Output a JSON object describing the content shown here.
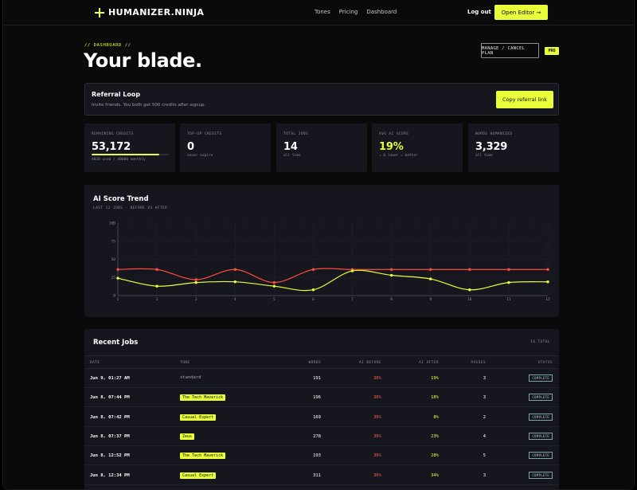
{
  "nav": {
    "logo": "HUMANIZER.NINJA",
    "links": [
      "Tones",
      "Pricing",
      "Dashboard"
    ],
    "logout": "Log out",
    "cta": "Open Editor →"
  },
  "header": {
    "eyebrow": "// DASHBOARD //",
    "title": "Your blade.",
    "manage_button": "MANAGE / CANCEL PLAN",
    "plan_badge": "PRO"
  },
  "referral": {
    "title": "Referral Loop",
    "subtitle": "Invite friends. You both get 500 credits after signup.",
    "button": "Copy referral link"
  },
  "stats": [
    {
      "label": "REMAINING CREDITS",
      "value": "53,172",
      "sub": "4828 used / 40000 monthly",
      "progress": 0.88
    },
    {
      "label": "TOP-UP CREDITS",
      "value": "0",
      "sub": "never expire"
    },
    {
      "label": "TOTAL JOBS",
      "value": "14",
      "sub": "all time"
    },
    {
      "label": "AVG AI SCORE",
      "value": "19%",
      "sub": "↘ & lower = better",
      "accent": true
    },
    {
      "label": "WORDS HUMANIZED",
      "value": "3,329",
      "sub": "all time"
    }
  ],
  "chart": {
    "title": "AI Score Trend",
    "subtitle": "LAST 12 JOBS · BEFORE VS AFTER"
  },
  "chart_data": {
    "type": "line",
    "x": [
      1,
      2,
      3,
      4,
      5,
      6,
      7,
      8,
      9,
      10,
      11,
      12
    ],
    "ylim": [
      0,
      100
    ],
    "yticks": [
      0,
      25,
      50,
      75,
      100
    ],
    "series": [
      {
        "color": "#ff4a3d",
        "values": [
          36,
          36,
          22,
          36,
          18,
          36,
          36,
          36,
          36,
          36,
          36,
          36
        ]
      },
      {
        "color": "#e8ff3a",
        "values": [
          24,
          13,
          18,
          19,
          13,
          8,
          34,
          28,
          23,
          8,
          18,
          19
        ]
      }
    ]
  },
  "jobs": {
    "title": "Recent Jobs",
    "total": "14 TOTAL",
    "columns": [
      "DATE",
      "TONE",
      "WORDS",
      "AI BEFORE",
      "AI AFTER",
      "PASSES",
      "STATUS"
    ],
    "rows": [
      {
        "date": "Jun 9, 01:27 AM",
        "tone": "standard",
        "tagged": false,
        "words": "191",
        "before": "36%",
        "after": "19%",
        "passes": "3",
        "status": "COMPLETE"
      },
      {
        "date": "Jun 8, 07:44 PM",
        "tone": "The Tech Maverick",
        "tagged": true,
        "words": "196",
        "before": "36%",
        "after": "18%",
        "passes": "3",
        "status": "COMPLETE"
      },
      {
        "date": "Jun 8, 07:42 PM",
        "tone": "Casual Expert",
        "tagged": true,
        "words": "169",
        "before": "36%",
        "after": "8%",
        "passes": "2",
        "status": "COMPLETE"
      },
      {
        "date": "Jun 8, 07:37 PM",
        "tone": "Zeus",
        "tagged": true,
        "words": "278",
        "before": "36%",
        "after": "23%",
        "passes": "4",
        "status": "COMPLETE"
      },
      {
        "date": "Jun 8, 12:52 PM",
        "tone": "The Tech Maverick",
        "tagged": true,
        "words": "193",
        "before": "36%",
        "after": "28%",
        "passes": "5",
        "status": "COMPLETE"
      },
      {
        "date": "Jun 8, 12:34 PM",
        "tone": "Casual Expert",
        "tagged": true,
        "words": "311",
        "before": "36%",
        "after": "34%",
        "passes": "3",
        "status": "COMPLETE"
      }
    ]
  }
}
